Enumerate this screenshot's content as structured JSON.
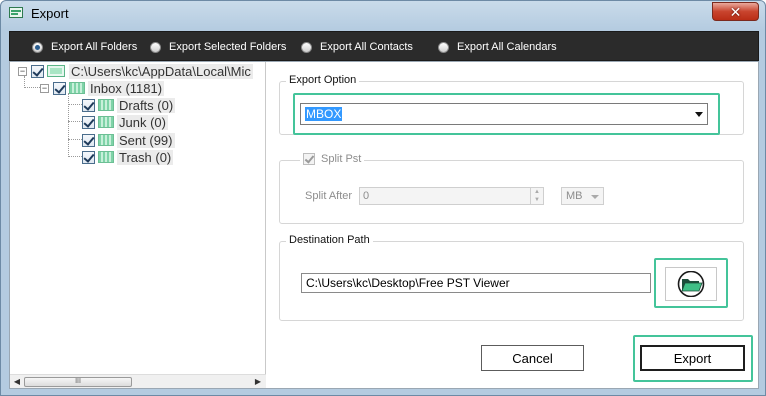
{
  "window": {
    "title": "Export",
    "close_symbol": "✕"
  },
  "export_modes": {
    "options": [
      {
        "label": "Export All Folders",
        "selected": true
      },
      {
        "label": "Export Selected Folders",
        "selected": false
      },
      {
        "label": "Export All Contacts",
        "selected": false
      },
      {
        "label": "Export All Calendars",
        "selected": false
      }
    ]
  },
  "tree": {
    "root": {
      "label": "C:\\Users\\kc\\AppData\\Local\\Mic",
      "checked": true,
      "expander": "−"
    },
    "inbox": {
      "label": "Inbox",
      "count": "(1181)",
      "checked": true,
      "expander": "−"
    },
    "children": [
      {
        "label": "Drafts",
        "count": "(0)",
        "checked": true
      },
      {
        "label": "Junk",
        "count": "(0)",
        "checked": true
      },
      {
        "label": "Sent",
        "count": "(99)",
        "checked": true
      },
      {
        "label": "Trash",
        "count": "(0)",
        "checked": true
      }
    ],
    "scroll_left": "◀",
    "scroll_right": "▶",
    "scroll_grip": "III"
  },
  "export_option": {
    "title": "Export Option",
    "selected_value": "MBOX"
  },
  "split": {
    "checkbox_label": "Split Pst",
    "checked": true,
    "enabled": false,
    "after_label": "Split After",
    "after_value": "0",
    "unit": "MB"
  },
  "destination": {
    "title": "Destination Path",
    "path": "C:\\Users\\kc\\Desktop\\Free PST Viewer"
  },
  "buttons": {
    "cancel": "Cancel",
    "export": "Export"
  },
  "colors": {
    "highlight": "#44c49a",
    "radio_bar": "#2b2b2b",
    "selection": "#3399ff",
    "folder_icon": "#7fd3a8"
  }
}
